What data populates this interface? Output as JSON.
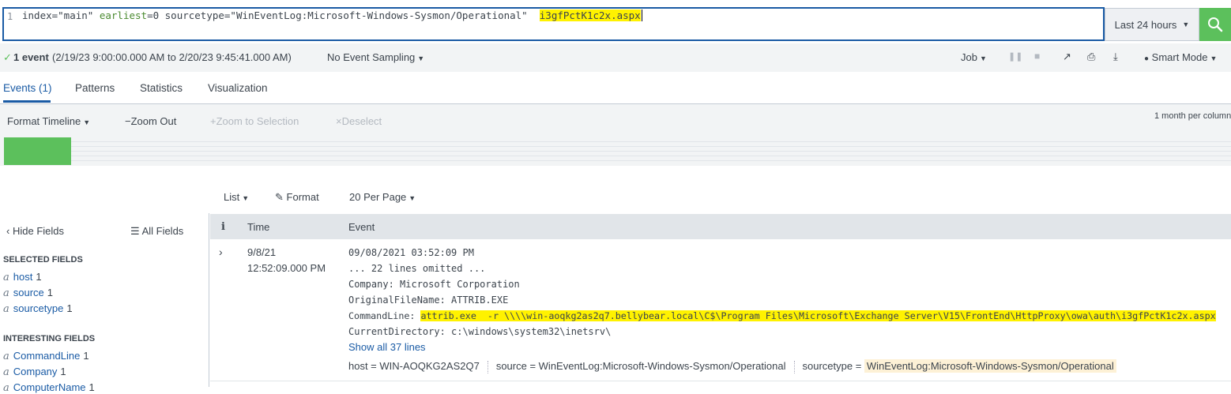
{
  "search": {
    "line_number": "1",
    "query_part1": "index=\"main\" ",
    "query_kw": "earliest",
    "query_part2": "=0 sourcetype=\"WinEventLog:Microsoft-Windows-Sysmon/Operational\"  ",
    "query_highlight": "i3gfPctK1c2x.aspx",
    "time_range": "Last 24 hours"
  },
  "status": {
    "check": "✓",
    "event_count": "1 event",
    "range": "(2/19/23 9:00:00.000 AM to 2/20/23 9:45:41.000 AM)",
    "sampling": "No Event Sampling",
    "job": "Job",
    "mode": "Smart Mode"
  },
  "tabs": [
    "Events (1)",
    "Patterns",
    "Statistics",
    "Visualization"
  ],
  "timeline": {
    "format": "Format Timeline",
    "zoom_out": "Zoom Out",
    "zoom_sel": "Zoom to Selection",
    "deselect": "Deselect",
    "scale": "1 month per column"
  },
  "results_toolbar": {
    "list": "List",
    "format": "Format",
    "per_page": "20 Per Page"
  },
  "fields_panel": {
    "hide": "Hide Fields",
    "all": "All Fields",
    "selected_heading": "SELECTED FIELDS",
    "selected": [
      {
        "name": "host",
        "count": "1"
      },
      {
        "name": "source",
        "count": "1"
      },
      {
        "name": "sourcetype",
        "count": "1"
      }
    ],
    "interesting_heading": "INTERESTING FIELDS",
    "interesting": [
      {
        "name": "CommandLine",
        "count": "1"
      },
      {
        "name": "Company",
        "count": "1"
      },
      {
        "name": "ComputerName",
        "count": "1"
      }
    ]
  },
  "table": {
    "col_info": "i",
    "col_time": "Time",
    "col_event": "Event"
  },
  "event": {
    "date": "9/8/21",
    "time": "12:52:09.000 PM",
    "lines": [
      "09/08/2021 03:52:09 PM",
      "... 22 lines omitted ...",
      "Company: Microsoft Corporation",
      "OriginalFileName: ATTRIB.EXE"
    ],
    "cmd_label": "CommandLine: ",
    "cmd_value": "attrib.exe  -r \\\\\\\\win-aoqkg2as2q7.bellybear.local\\C$\\Program Files\\Microsoft\\Exchange Server\\V15\\FrontEnd\\HttpProxy\\owa\\auth\\i3gfPctK1c2x.aspx",
    "cwd": "CurrentDirectory: c:\\windows\\system32\\inetsrv\\",
    "show_all": "Show all 37 lines",
    "host_label": "host = ",
    "host_value": "WIN-AOQKG2AS2Q7",
    "source_label": "source = ",
    "source_value": "WinEventLog:Microsoft-Windows-Sysmon/Operational",
    "sourcetype_label": "sourcetype = ",
    "sourcetype_value": "WinEventLog:Microsoft-Windows-Sysmon/Operational"
  }
}
